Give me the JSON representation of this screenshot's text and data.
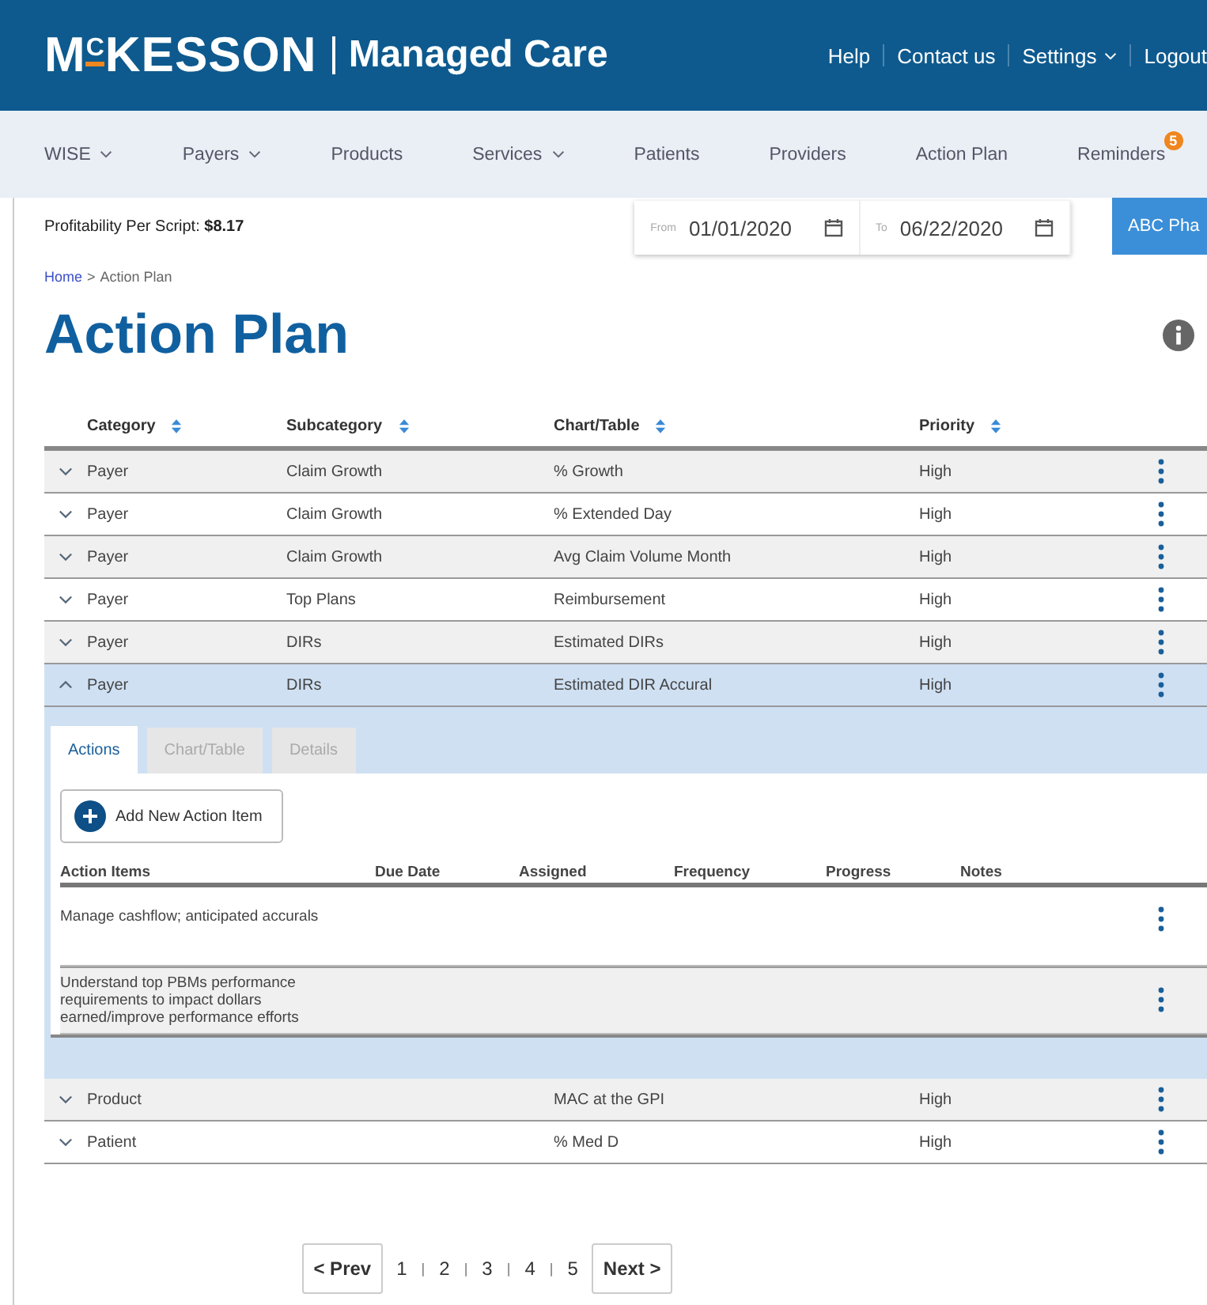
{
  "header": {
    "logo": "M$^{C}$KESSON",
    "product": "Managed Care",
    "links": [
      {
        "label": "Help",
        "dropdown": false
      },
      {
        "label": "Contact us",
        "dropdown": false
      },
      {
        "label": "Settings",
        "dropdown": true
      },
      {
        "label": "Logout",
        "dropdown": false
      }
    ]
  },
  "nav": [
    {
      "label": "WISE",
      "dropdown": true
    },
    {
      "label": "Payers",
      "dropdown": true
    },
    {
      "label": "Products",
      "dropdown": false
    },
    {
      "label": "Services",
      "dropdown": true
    },
    {
      "label": "Patients",
      "dropdown": false
    },
    {
      "label": "Providers",
      "dropdown": false
    },
    {
      "label": "Action Plan",
      "dropdown": false
    },
    {
      "label": "Reminders",
      "dropdown": false,
      "badge": "5"
    }
  ],
  "profitability": "Profitability Per Script: **$8.17**",
  "date_range": {
    "from_label": "From",
    "from": "01/01/2020",
    "to_label": "To",
    "to": "06/22/2020"
  },
  "pharmacy_button": "ABC Pha",
  "breadcrumb": {
    "items": [
      "Home",
      "Action Plan"
    ],
    "separator": ">"
  },
  "title": "Action Plan",
  "table": {
    "columns": [
      "Category",
      "Subcategory",
      "Chart/Table",
      "Priority"
    ],
    "rows": [
      {
        "category": "Payer",
        "subcategory": "Claim Growth",
        "chart_table": "% Growth",
        "priority": "High",
        "expanded": false
      },
      {
        "category": "Payer",
        "subcategory": "Claim Growth",
        "chart_table": "% Extended Day",
        "priority": "High",
        "expanded": false
      },
      {
        "category": "Payer",
        "subcategory": "Claim Growth",
        "chart_table": "Avg Claim Volume Month",
        "priority": "High",
        "expanded": false
      },
      {
        "category": "Payer",
        "subcategory": "Top Plans",
        "chart_table": "Reimbursement",
        "priority": "High",
        "expanded": false
      },
      {
        "category": "Payer",
        "subcategory": "DIRs",
        "chart_table": "Estimated DIRs",
        "priority": "High",
        "expanded": false
      },
      {
        "category": "Payer",
        "subcategory": "DIRs",
        "chart_table": "Estimated DIR Accural",
        "priority": "High",
        "expanded": true,
        "detail": {
          "tabs": [
            {
              "label": "Actions",
              "selected": true
            },
            {
              "label": "Chart/Table",
              "selected": false
            },
            {
              "label": "Details",
              "selected": false
            }
          ],
          "add_button": "Add New Action Item",
          "columns": [
            "Action Items",
            "Due Date",
            "Assigned",
            "Frequency",
            "Progress",
            "Notes"
          ],
          "items": [
            "Manage cashflow; anticipated accurals",
            "Understand top PBMs performance requirements to impact dollars earned/improve performance efforts"
          ]
        }
      },
      {
        "category": "Product",
        "chart_table": "MAC at the GPI",
        "priority": "High",
        "expanded": false
      },
      {
        "category": "Patient",
        "chart_table": "% Med D",
        "priority": "High",
        "expanded": false
      }
    ]
  },
  "pagination": {
    "prev": "< Prev",
    "pages": [
      "1",
      "2",
      "3",
      "4",
      "5"
    ],
    "separator": "|",
    "next": "Next >"
  }
}
